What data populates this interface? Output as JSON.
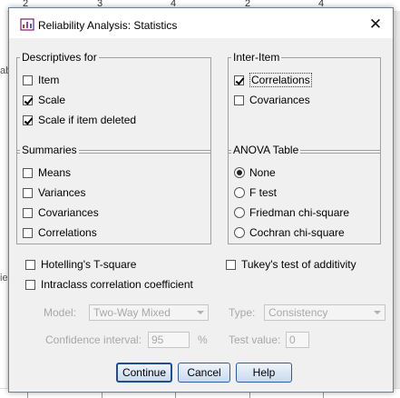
{
  "background": {
    "ruler_ticks": [
      "2",
      "3",
      "4",
      "2",
      "4"
    ],
    "left_text": "ab",
    "left_text_2": "ie"
  },
  "dialog": {
    "title": "Reliability Analysis: Statistics",
    "close_glyph": "✕"
  },
  "descriptives": {
    "legend": "Descriptives for",
    "options": [
      {
        "label": "Item",
        "checked": false
      },
      {
        "label": "Scale",
        "checked": true
      },
      {
        "label": "Scale if item deleted",
        "checked": true
      }
    ]
  },
  "inter_item": {
    "legend": "Inter-Item",
    "options": [
      {
        "label": "Correlations",
        "checked": true
      },
      {
        "label": "Covariances",
        "checked": false
      }
    ]
  },
  "summaries": {
    "legend": "Summaries",
    "options": [
      {
        "label": "Means",
        "checked": false
      },
      {
        "label": "Variances",
        "checked": false
      },
      {
        "label": "Covariances",
        "checked": false
      },
      {
        "label": "Correlations",
        "checked": false
      }
    ]
  },
  "anova": {
    "legend": "ANOVA Table",
    "options": [
      {
        "label": "None",
        "selected": true
      },
      {
        "label": "F test",
        "selected": false
      },
      {
        "label": "Friedman chi-square",
        "selected": false
      },
      {
        "label": "Cochran chi-square",
        "selected": false
      }
    ]
  },
  "extras": {
    "hotelling": {
      "label": "Hotelling's T-square",
      "checked": false
    },
    "tukey": {
      "label": "Tukey's test of additivity",
      "checked": false
    },
    "icc": {
      "label": "Intraclass correlation coefficient",
      "checked": false
    }
  },
  "icc_settings": {
    "model_label": "Model:",
    "model_value": "Two-Way Mixed",
    "type_label": "Type:",
    "type_value": "Consistency",
    "ci_label": "Confidence interval:",
    "ci_value": "95",
    "ci_unit": "%",
    "test_value_label": "Test value:",
    "test_value": "0"
  },
  "buttons": {
    "continue": "Continue",
    "cancel": "Cancel",
    "help": "Help"
  },
  "colors": {
    "accent": "#1d4f91",
    "dialog_bg": "#f0f0f0",
    "disabled_text": "#a8a8a8"
  }
}
